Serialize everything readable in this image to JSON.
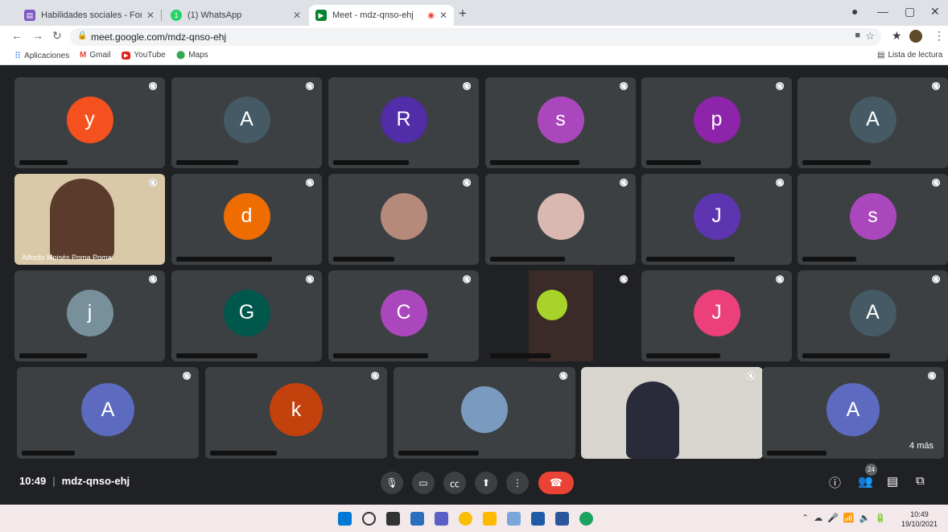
{
  "browser": {
    "tabs": [
      {
        "title": "Habilidades sociales - Formulario",
        "color": "#7e57c2",
        "glyph": "▤"
      },
      {
        "title": "(1) WhatsApp",
        "color": "#25d366",
        "glyph": "1"
      },
      {
        "title": "Meet - mdz-qnso-ehj",
        "color": "#00832d",
        "glyph": "▶"
      }
    ],
    "url": "meet.google.com/mdz-qnso-ehj",
    "bookmarks": [
      "Aplicaciones",
      "Gmail",
      "YouTube",
      "Maps"
    ],
    "reading_list": "Lista de lectura"
  },
  "meeting": {
    "code": "mdz-qnso-ehj",
    "time": "10:49",
    "participant_count": "24",
    "more_label": "4 más",
    "visible_name": "Alfredo Moisés Poma Poma",
    "tiles": [
      {
        "letter": "y",
        "color": "#f4511e"
      },
      {
        "letter": "A",
        "color": "#455a64"
      },
      {
        "letter": "R",
        "color": "#512da8"
      },
      {
        "letter": "s",
        "color": "#ab47bc"
      },
      {
        "letter": "p",
        "color": "#8e24aa"
      },
      {
        "letter": "A",
        "color": "#455a64"
      },
      {
        "letter": "",
        "color": ""
      },
      {
        "letter": "d",
        "color": "#ef6c00"
      },
      {
        "letter": "",
        "color": ""
      },
      {
        "letter": "",
        "color": ""
      },
      {
        "letter": "J",
        "color": "#5e35b1"
      },
      {
        "letter": "s",
        "color": "#ab47bc"
      },
      {
        "letter": "j",
        "color": "#78909c"
      },
      {
        "letter": "G",
        "color": "#00574b"
      },
      {
        "letter": "C",
        "color": "#ab47bc"
      },
      {
        "letter": "",
        "color": ""
      },
      {
        "letter": "J",
        "color": "#ec407a"
      },
      {
        "letter": "A",
        "color": "#455a64"
      },
      {
        "letter": "A",
        "color": "#5c6bc0"
      },
      {
        "letter": "k",
        "color": "#c2410c"
      },
      {
        "letter": "",
        "color": ""
      },
      {
        "letter": "",
        "color": ""
      },
      {
        "letter": "A",
        "color": "#5c6bc0"
      }
    ]
  },
  "taskbar": {
    "time": "10:49",
    "date": "19/10/2021"
  }
}
